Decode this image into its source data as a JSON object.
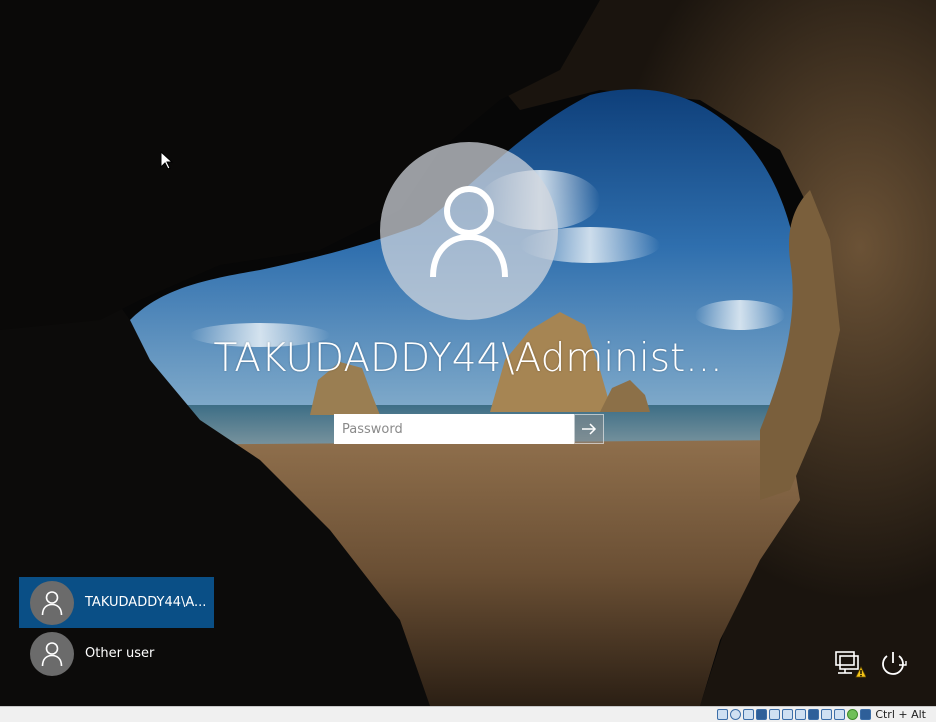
{
  "login": {
    "username_display": "TAKUDADDY44\\Administ...",
    "password_placeholder": "Password",
    "avatar_icon": "user-silhouette-icon",
    "submit_icon": "arrow-right-icon"
  },
  "user_list": [
    {
      "label": "TAKUDADDY44\\A...",
      "selected": true,
      "icon": "user-silhouette-icon"
    },
    {
      "label": "Other user",
      "selected": false,
      "icon": "user-silhouette-icon"
    }
  ],
  "corner_icons": {
    "network": "network-warning-icon",
    "power": "power-icon"
  },
  "host_bar": {
    "host_key_label": "Ctrl + Alt",
    "icons": [
      "hard-disk-icon",
      "optical-drive-icon",
      "audio-icon",
      "network-adapter-icon",
      "usb-icon",
      "shared-folder-icon",
      "display-icon",
      "video-capture-icon",
      "recording-icon",
      "cpu-icon",
      "mouse-integration-icon",
      "download-icon"
    ]
  },
  "colors": {
    "selected_user_bg": "#0a4f86",
    "user_avatar_bg": "#6b6b6b",
    "host_bar_bg": "#f0f0f0"
  }
}
